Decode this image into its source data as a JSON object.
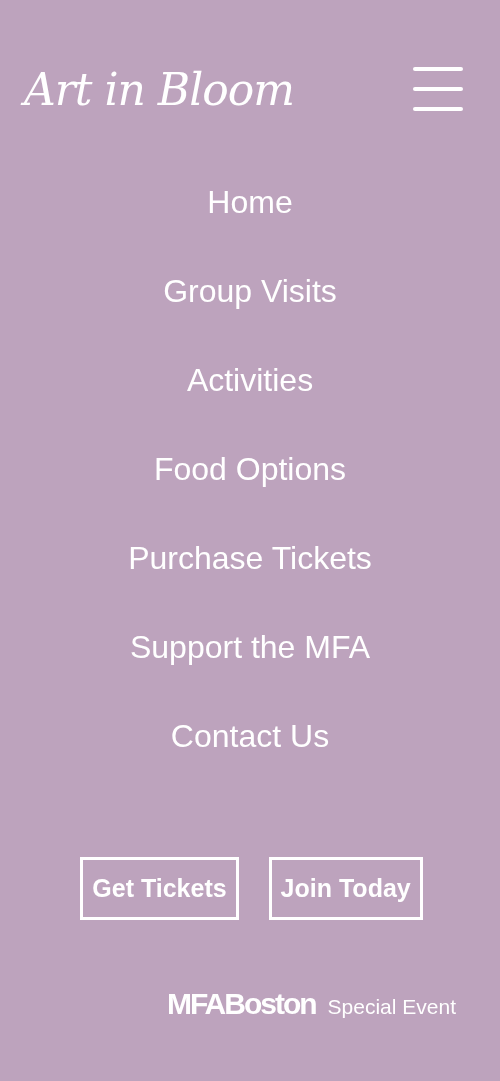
{
  "header": {
    "logo": "Art in Bloom"
  },
  "nav": {
    "items": [
      {
        "label": "Home"
      },
      {
        "label": "Group Visits"
      },
      {
        "label": "Activities"
      },
      {
        "label": "Food Options"
      },
      {
        "label": "Purchase Tickets"
      },
      {
        "label": "Support the MFA"
      },
      {
        "label": "Contact Us"
      }
    ]
  },
  "buttons": [
    "Get Tickets",
    "Join Today"
  ],
  "footer": {
    "brand": "MFABoston",
    "tagline": "Special Event"
  }
}
